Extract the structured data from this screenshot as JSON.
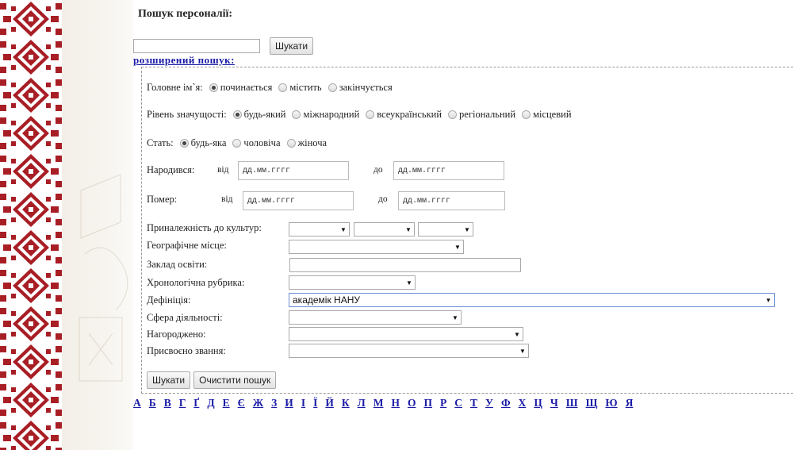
{
  "search": {
    "title": "Пошук персоналії:",
    "input_value": "",
    "button_label": "Шукати",
    "advanced_link": "розширений пошук:"
  },
  "advanced": {
    "main_name": {
      "label": "Головне ім`я:",
      "options": [
        "починається",
        "містить",
        "закінчується"
      ],
      "selected": 0
    },
    "significance": {
      "label": "Рівень значущості:",
      "options": [
        "будь-який",
        "міжнародний",
        "всеукраїнський",
        "регіональний",
        "місцевий"
      ],
      "selected": 0
    },
    "gender": {
      "label": "Стать:",
      "options": [
        "будь-яка",
        "чоловіча",
        "жіноча"
      ],
      "selected": 0
    },
    "born": {
      "label": "Народився:",
      "from_label": "від",
      "to_label": "до",
      "from_value": "дд.мм.гггг",
      "to_value": "дд.мм.гггг"
    },
    "died": {
      "label": "Помер:",
      "from_label": "від",
      "to_label": "до",
      "from_value": "дд.мм.гггг",
      "to_value": "дд.мм.гггг"
    },
    "fields": {
      "culture": {
        "label": "Приналежність до культур:",
        "values": [
          "",
          "",
          ""
        ]
      },
      "geo": {
        "label": "Географічне місце:",
        "value": ""
      },
      "education": {
        "label": "Заклад освіти:",
        "value": ""
      },
      "chrono": {
        "label": "Хронологічна рубрика:",
        "value": ""
      },
      "definition": {
        "label": "Дефініція:",
        "value": "академік НАНУ"
      },
      "sphere": {
        "label": "Сфера діяльності:",
        "value": ""
      },
      "awarded": {
        "label": "Нагороджено:",
        "value": ""
      },
      "title": {
        "label": "Присвоєно звання:",
        "value": ""
      }
    },
    "submit_label": "Шукати",
    "clear_label": "Очистити пошук"
  },
  "alphabet": [
    "А",
    "Б",
    "В",
    "Г",
    "Ґ",
    "Д",
    "Е",
    "Є",
    "Ж",
    "З",
    "И",
    "І",
    "Ї",
    "Й",
    "К",
    "Л",
    "М",
    "Н",
    "О",
    "П",
    "Р",
    "С",
    "Т",
    "У",
    "Ф",
    "Х",
    "Ц",
    "Ч",
    "Ш",
    "Щ",
    "Ю",
    "Я"
  ],
  "colors": {
    "ornament": "#a81e25",
    "link": "#1a1aa6"
  }
}
